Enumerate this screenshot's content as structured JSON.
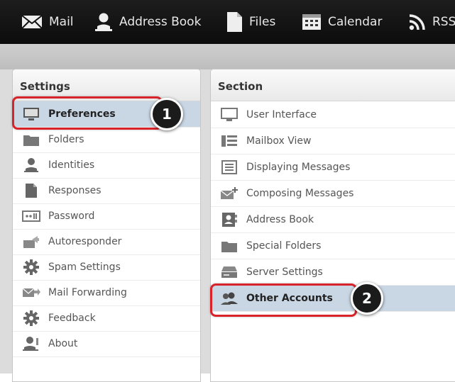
{
  "topnav": {
    "items": [
      {
        "label": "Mail",
        "icon": "mail-icon"
      },
      {
        "label": "Address Book",
        "icon": "person-icon"
      },
      {
        "label": "Files",
        "icon": "file-icon"
      },
      {
        "label": "Calendar",
        "icon": "calendar-icon"
      },
      {
        "label": "RSS",
        "icon": "rss-icon"
      }
    ]
  },
  "settings": {
    "title": "Settings",
    "items": [
      {
        "label": "Preferences",
        "icon": "monitor-icon",
        "selected": true
      },
      {
        "label": "Folders",
        "icon": "folder-icon"
      },
      {
        "label": "Identities",
        "icon": "person-icon"
      },
      {
        "label": "Responses",
        "icon": "document-icon"
      },
      {
        "label": "Password",
        "icon": "password-icon"
      },
      {
        "label": "Autoresponder",
        "icon": "autoresponder-icon"
      },
      {
        "label": "Spam Settings",
        "icon": "gear-icon"
      },
      {
        "label": "Mail Forwarding",
        "icon": "forward-mail-icon"
      },
      {
        "label": "Feedback",
        "icon": "gear-icon"
      },
      {
        "label": "About",
        "icon": "about-icon"
      }
    ]
  },
  "section": {
    "title": "Section",
    "items": [
      {
        "label": "User Interface",
        "icon": "monitor-icon"
      },
      {
        "label": "Mailbox View",
        "icon": "mailbox-view-icon"
      },
      {
        "label": "Displaying Messages",
        "icon": "display-messages-icon"
      },
      {
        "label": "Composing Messages",
        "icon": "compose-icon"
      },
      {
        "label": "Address Book",
        "icon": "address-card-icon"
      },
      {
        "label": "Special Folders",
        "icon": "folder-icon"
      },
      {
        "label": "Server Settings",
        "icon": "server-icon"
      },
      {
        "label": "Other Accounts",
        "icon": "accounts-icon",
        "selected": true
      }
    ]
  },
  "callouts": [
    {
      "number": "1"
    },
    {
      "number": "2"
    }
  ],
  "colors": {
    "topbar": "#111111",
    "selected_row": "#c9d6e3",
    "callout_border": "#d8232a",
    "badge": "#1b1b1b"
  }
}
